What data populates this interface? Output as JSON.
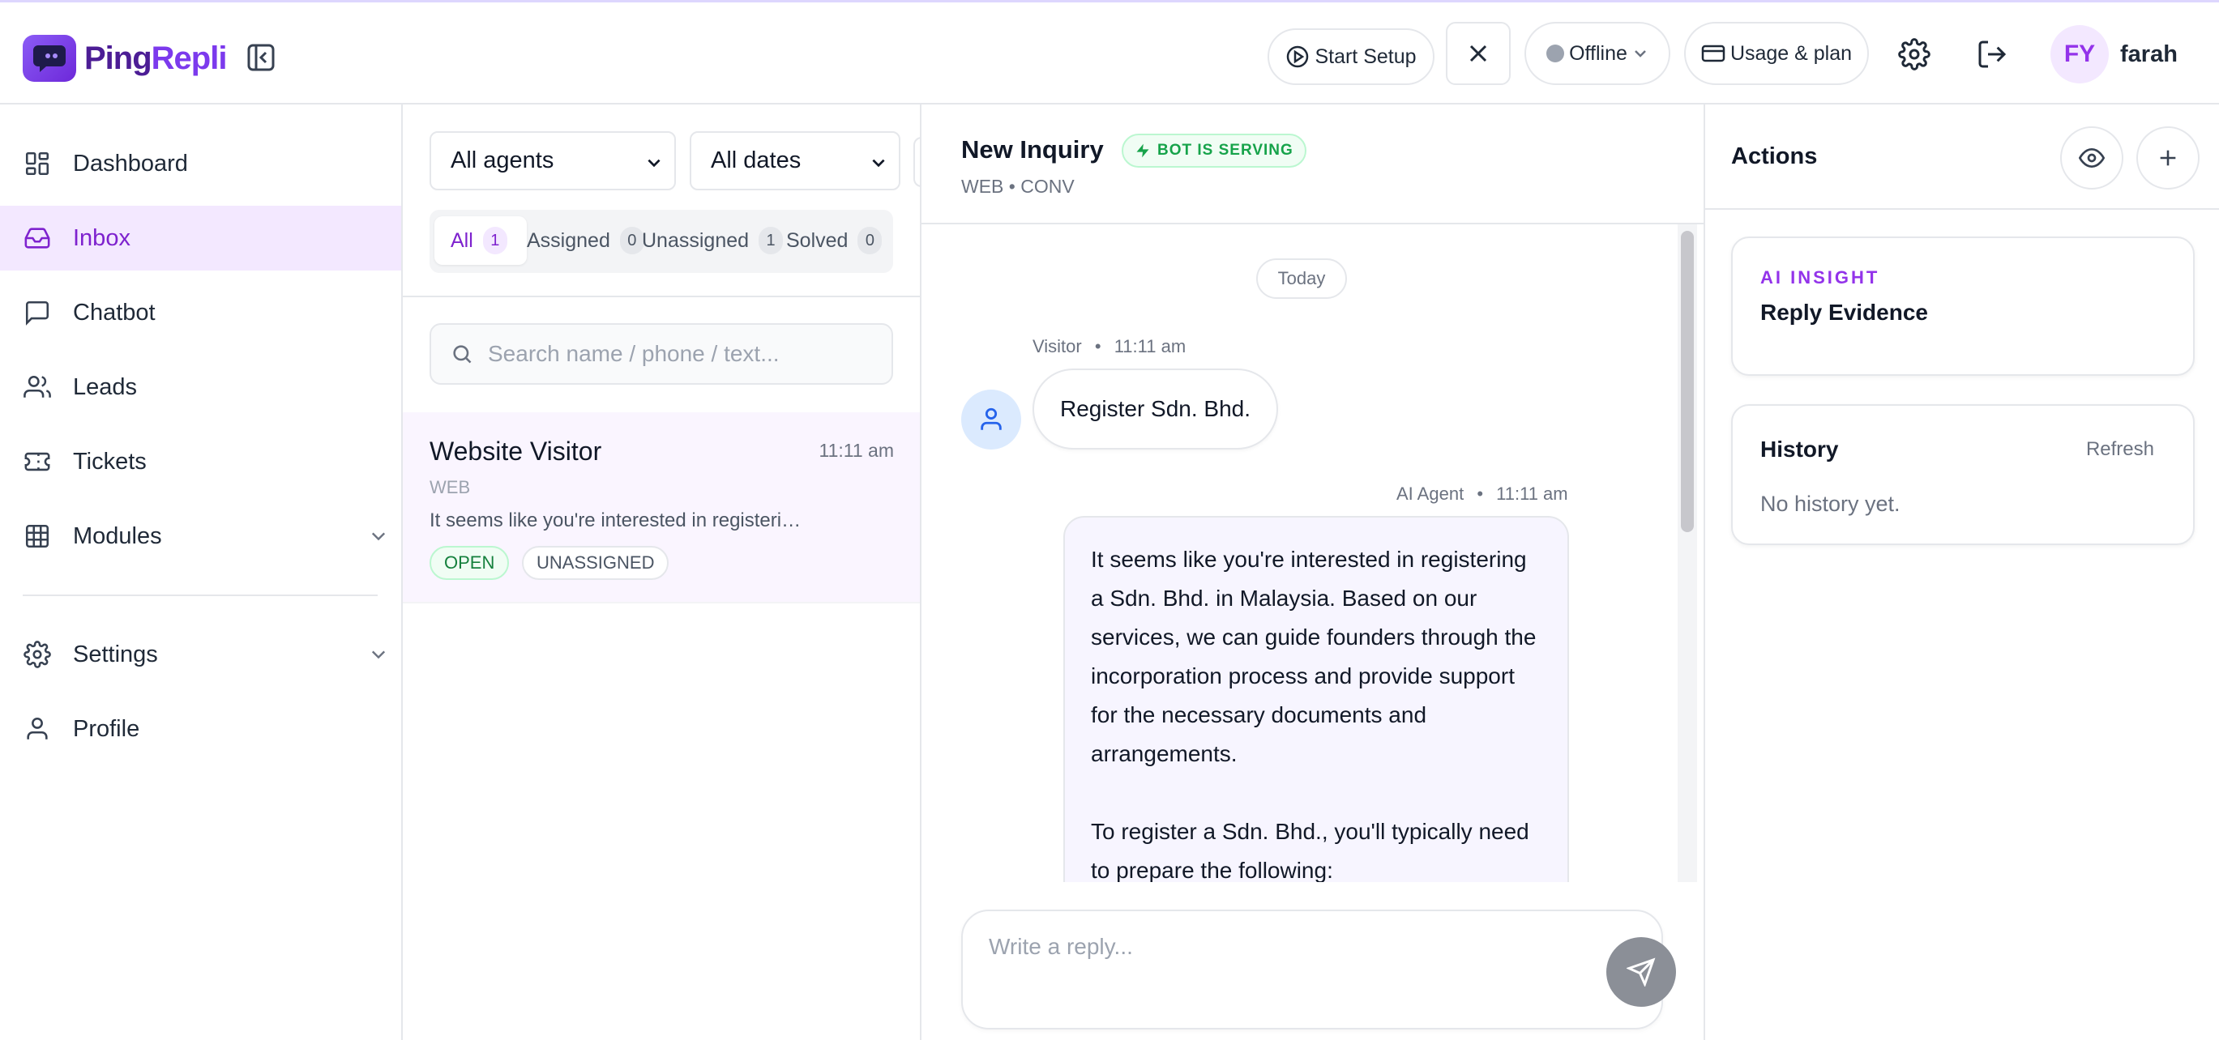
{
  "brand": {
    "name_part1": "Ping",
    "name_part2": "Repli"
  },
  "header": {
    "start_setup_label": "Start Setup",
    "status_label": "Offline",
    "usage_label": "Usage & plan",
    "avatar_initials": "FY",
    "username": "farah"
  },
  "sidebar": {
    "items": [
      {
        "label": "Dashboard",
        "icon": "dashboard-icon"
      },
      {
        "label": "Inbox",
        "icon": "inbox-icon",
        "active": true
      },
      {
        "label": "Chatbot",
        "icon": "chat-icon"
      },
      {
        "label": "Leads",
        "icon": "users-icon"
      },
      {
        "label": "Tickets",
        "icon": "ticket-icon"
      },
      {
        "label": "Modules",
        "icon": "grid-icon",
        "expandable": true
      },
      {
        "label": "Settings",
        "icon": "gear-icon",
        "expandable": true
      },
      {
        "label": "Profile",
        "icon": "user-icon"
      }
    ]
  },
  "filters": {
    "agent_select": "All agents",
    "date_select": "All dates",
    "tabs": [
      {
        "label": "All",
        "count": "1"
      },
      {
        "label": "Assigned",
        "count": "0"
      },
      {
        "label": "Unassigned",
        "count": "1"
      },
      {
        "label": "Solved",
        "count": "0"
      }
    ],
    "search_placeholder": "Search name / phone / text..."
  },
  "conversations": [
    {
      "name": "Website Visitor",
      "time": "11:11 am",
      "channel": "WEB",
      "preview": "It seems like you're interested in registering a Sdn. Bhd. in Malaysia.",
      "status": "OPEN",
      "assignment": "UNASSIGNED"
    }
  ],
  "chat": {
    "title": "New Inquiry",
    "bot_badge": "BOT IS SERVING",
    "subtitle": "WEB • CONV",
    "date_divider": "Today",
    "messages": [
      {
        "sender": "Visitor",
        "separator": "•",
        "time": "11:11 am",
        "text": "Register Sdn. Bhd."
      },
      {
        "sender": "AI Agent",
        "separator": "•",
        "time": "11:11 am",
        "paragraph1": "It seems like you're interested in registering a Sdn. Bhd. in Malaysia. Based on our services, we can guide founders through the incorporation process and provide support for the necessary documents and arrangements.",
        "paragraph2": "To register a Sdn. Bhd., you'll typically need to prepare the following:"
      }
    ],
    "reply_placeholder": "Write a reply..."
  },
  "actions_panel": {
    "title": "Actions",
    "insight_kicker": "AI INSIGHT",
    "insight_title": "Reply Evidence",
    "history_title": "History",
    "refresh_label": "Refresh",
    "history_empty": "No history yet."
  },
  "colors": {
    "accent": "#7e22ce",
    "accent_light": "#f3e8ff",
    "success": "#16a34a",
    "border": "#e5e7eb"
  }
}
